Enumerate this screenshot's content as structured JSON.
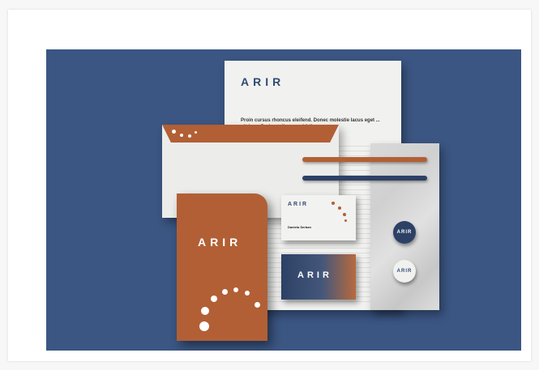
{
  "brand": {
    "wordmark": "ARIR",
    "primary_color": "#3b5683",
    "accent_color": "#b25f35",
    "paper_color": "#f1f1ef"
  },
  "letterhead": {
    "logo": "ARIR",
    "body_text": "Proin cursus rhoncus eleifend. Donec molestie lacus eget ... ultrices. Proin at diam ... mi felis."
  },
  "folder": {
    "logo": "ARIR"
  },
  "business_card_front": {
    "logo": "ARIR",
    "name": "Daniela Serban"
  },
  "business_card_back": {
    "logo": "ARIR"
  },
  "badges": [
    {
      "label": "ARIR"
    },
    {
      "label": "ARIR"
    }
  ]
}
